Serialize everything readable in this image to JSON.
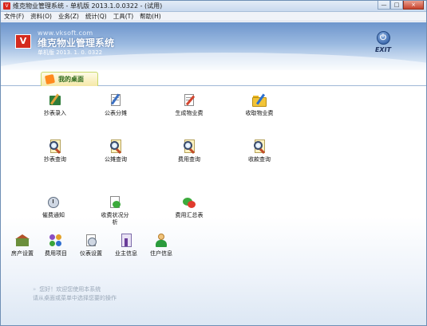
{
  "window": {
    "title": "维克物业管理系统 - 单机版 2013.1.0.0322 - (试用)",
    "buttons": [
      "—",
      "□",
      "×"
    ]
  },
  "menubar": {
    "items": [
      "文件(F)",
      "资料(O)",
      "业务(Z)",
      "统计(Q)",
      "工具(T)",
      "帮助(H)"
    ]
  },
  "banner": {
    "logo_letter": "V",
    "url": "www.vksoft.com",
    "app_name": "维克物业管理系统",
    "edition": "单机版  2013. 1. 0. 0322",
    "exit_label": "EXIT",
    "exit_icon": "exit-power-icon"
  },
  "tabs": [
    {
      "label": "我的桌面",
      "icon": "desktop-tab-icon"
    }
  ],
  "tiles": [
    {
      "label": "抄表录入",
      "icon": "meter-entry-icon"
    },
    {
      "label": "公表分摊",
      "icon": "public-meter-share-icon"
    },
    {
      "label": "生成物业费",
      "icon": "generate-fee-icon"
    },
    {
      "label": "收取物业费",
      "icon": "collect-fee-folder-icon"
    },
    {
      "label": "抄表查询",
      "icon": "meter-query-icon"
    },
    {
      "label": "公摊查询",
      "icon": "share-query-icon"
    },
    {
      "label": "费用查询",
      "icon": "fee-query-icon"
    },
    {
      "label": "收款查询",
      "icon": "payment-query-icon"
    },
    {
      "label": "催费通知",
      "icon": "payment-reminder-icon"
    },
    {
      "label": "收费状况分析",
      "icon": "charge-analysis-icon"
    },
    {
      "label": "费用汇总表",
      "icon": "fee-summary-icon"
    },
    {
      "label": "房产设置",
      "icon": "property-settings-icon"
    },
    {
      "label": "费用项目",
      "icon": "fee-items-icon"
    },
    {
      "label": "仪表设置",
      "icon": "meter-settings-icon"
    },
    {
      "label": "业主信息",
      "icon": "owner-info-icon"
    },
    {
      "label": "住户信息",
      "icon": "resident-info-icon"
    }
  ],
  "hint": {
    "line1": "您好！欢迎您使用本系统",
    "line2": "请从桌面或菜单中选择您要的操作"
  }
}
